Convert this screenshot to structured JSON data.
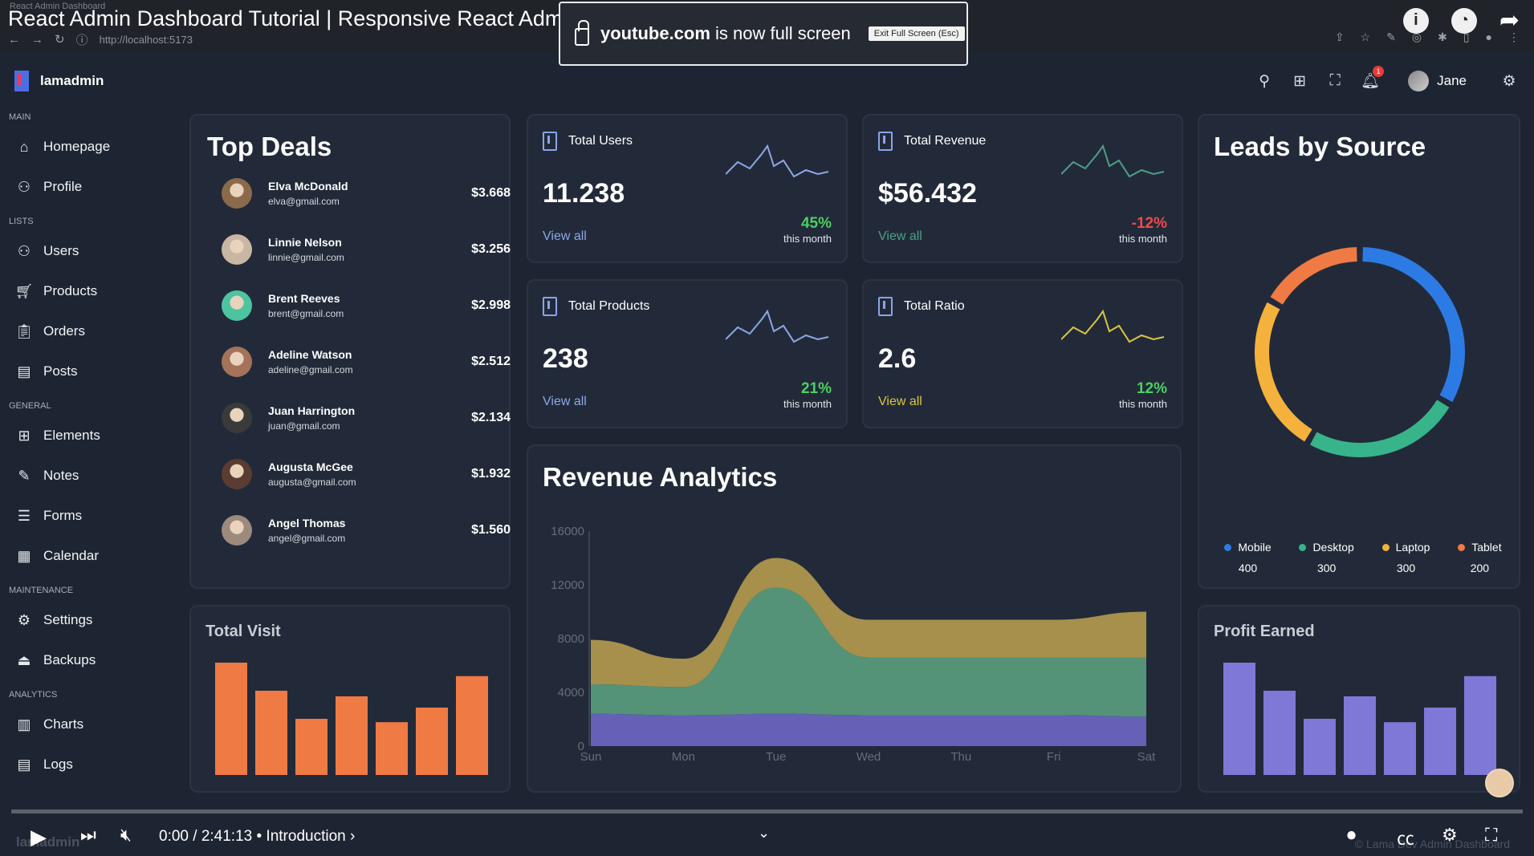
{
  "browser": {
    "video_title": "React Admin Dashboard Tutorial | Responsive React Admin Panel UI Design Course",
    "tab_label": "React Admin Dashboard",
    "url": "http://localhost:5173"
  },
  "fullscreen_toast": {
    "site": "youtube.com",
    "message": " is now full screen",
    "exit_button": "Exit Full Screen (Esc)"
  },
  "header": {
    "logo_text": "lamadmin",
    "user_name": "Jane",
    "notification_count": "1"
  },
  "sidebar": {
    "sections": [
      {
        "title": "MAIN",
        "items": [
          {
            "label": "Homepage",
            "icon": "home-icon"
          },
          {
            "label": "Profile",
            "icon": "person-icon"
          }
        ]
      },
      {
        "title": "LISTS",
        "items": [
          {
            "label": "Users",
            "icon": "person-icon"
          },
          {
            "label": "Products",
            "icon": "cart-icon"
          },
          {
            "label": "Orders",
            "icon": "clipboard-icon"
          },
          {
            "label": "Posts",
            "icon": "document-icon"
          }
        ]
      },
      {
        "title": "GENERAL",
        "items": [
          {
            "label": "Elements",
            "icon": "grid-icon"
          },
          {
            "label": "Notes",
            "icon": "edit-icon"
          },
          {
            "label": "Forms",
            "icon": "lines-icon"
          },
          {
            "label": "Calendar",
            "icon": "calendar-icon"
          }
        ]
      },
      {
        "title": "MAINTENANCE",
        "items": [
          {
            "label": "Settings",
            "icon": "gear-icon"
          },
          {
            "label": "Backups",
            "icon": "backup-icon"
          }
        ]
      },
      {
        "title": "ANALYTICS",
        "items": [
          {
            "label": "Charts",
            "icon": "bar-chart-icon"
          },
          {
            "label": "Logs",
            "icon": "document-icon"
          }
        ]
      }
    ]
  },
  "top_deals": {
    "title": "Top Deals",
    "rows": [
      {
        "name": "Elva McDonald",
        "email": "elva@gmail.com",
        "amount": "$3.668",
        "avatar_color": "#8a6a4b"
      },
      {
        "name": "Linnie Nelson",
        "email": "linnie@gmail.com",
        "amount": "$3.256",
        "avatar_color": "#c9b6a4"
      },
      {
        "name": "Brent Reeves",
        "email": "brent@gmail.com",
        "amount": "$2.998",
        "avatar_color": "#4cc4a0"
      },
      {
        "name": "Adeline Watson",
        "email": "adeline@gmail.com",
        "amount": "$2.512",
        "avatar_color": "#a4735a"
      },
      {
        "name": "Juan Harrington",
        "email": "juan@gmail.com",
        "amount": "$2.134",
        "avatar_color": "#3a3a3a"
      },
      {
        "name": "Augusta McGee",
        "email": "augusta@gmail.com",
        "amount": "$1.932",
        "avatar_color": "#5a3c33"
      },
      {
        "name": "Angel Thomas",
        "email": "angel@gmail.com",
        "amount": "$1.560",
        "avatar_color": "#9d8a7c"
      }
    ]
  },
  "stats": [
    {
      "title": "Total Users",
      "value": "11.238",
      "link": "View all",
      "pct": "45%",
      "period": "this month",
      "pct_color": "#4ccf62",
      "link_color": "#8ea6e6",
      "line_color": "#8ea6e6"
    },
    {
      "title": "Total Revenue",
      "value": "$56.432",
      "link": "View all",
      "pct": "-12%",
      "period": "this month",
      "pct_color": "#ee4b4b",
      "link_color": "#4c9f8a",
      "line_color": "#4c9f8a"
    },
    {
      "title": "Total Products",
      "value": "238",
      "link": "View all",
      "pct": "21%",
      "period": "this month",
      "pct_color": "#4ccf62",
      "link_color": "#8ea6e6",
      "line_color": "#8ea6e6"
    },
    {
      "title": "Total Ratio",
      "value": "2.6",
      "link": "View all",
      "pct": "12%",
      "period": "this month",
      "pct_color": "#4ccf62",
      "link_color": "#d9c542",
      "line_color": "#d9c542"
    }
  ],
  "revenue": {
    "title": "Revenue Analytics"
  },
  "leads": {
    "title": "Leads by Source"
  },
  "total_visit": {
    "title": "Total Visit"
  },
  "profit": {
    "title": "Profit Earned"
  },
  "video_controls": {
    "time": "0:00 / 2:41:13",
    "chapter": "• Introduction ›",
    "watermark": "© Lama Dev Admin Dashboard",
    "watermark_left": "lamadmin"
  },
  "chart_data": [
    {
      "type": "area",
      "title": "Revenue Analytics",
      "categories": [
        "Sun",
        "Mon",
        "Tue",
        "Wed",
        "Thu",
        "Fri",
        "Sat"
      ],
      "ylim": [
        0,
        16000
      ],
      "yticks": [
        0,
        4000,
        8000,
        12000,
        16000
      ],
      "stacked": true,
      "series": [
        {
          "name": "",
          "color": "#6b67c4",
          "values": [
            2400,
            2300,
            2400,
            2300,
            2300,
            2300,
            2200
          ]
        },
        {
          "name": "",
          "color": "#5a9e7e",
          "values": [
            2200,
            2100,
            9400,
            4300,
            4300,
            4300,
            4400
          ]
        },
        {
          "name": "",
          "color": "#b59b4f",
          "values": [
            3300,
            2100,
            2200,
            2800,
            2800,
            2800,
            3400
          ]
        }
      ]
    },
    {
      "type": "pie",
      "title": "Leads by Source",
      "legend_position": "bottom",
      "slices": [
        {
          "label": "Mobile",
          "value": 400,
          "color": "#2c7be5"
        },
        {
          "label": "Desktop",
          "value": 300,
          "color": "#38b48a"
        },
        {
          "label": "Laptop",
          "value": 300,
          "color": "#f4b23c"
        },
        {
          "label": "Tablet",
          "value": 200,
          "color": "#f07a43"
        }
      ]
    },
    {
      "type": "bar",
      "title": "Total Visit",
      "color": "#f07a43",
      "values": [
        100,
        75,
        50,
        70,
        47,
        60,
        88
      ]
    },
    {
      "type": "bar",
      "title": "Profit Earned",
      "color": "#7f78d6",
      "values": [
        100,
        75,
        50,
        70,
        47,
        60,
        88
      ]
    }
  ]
}
